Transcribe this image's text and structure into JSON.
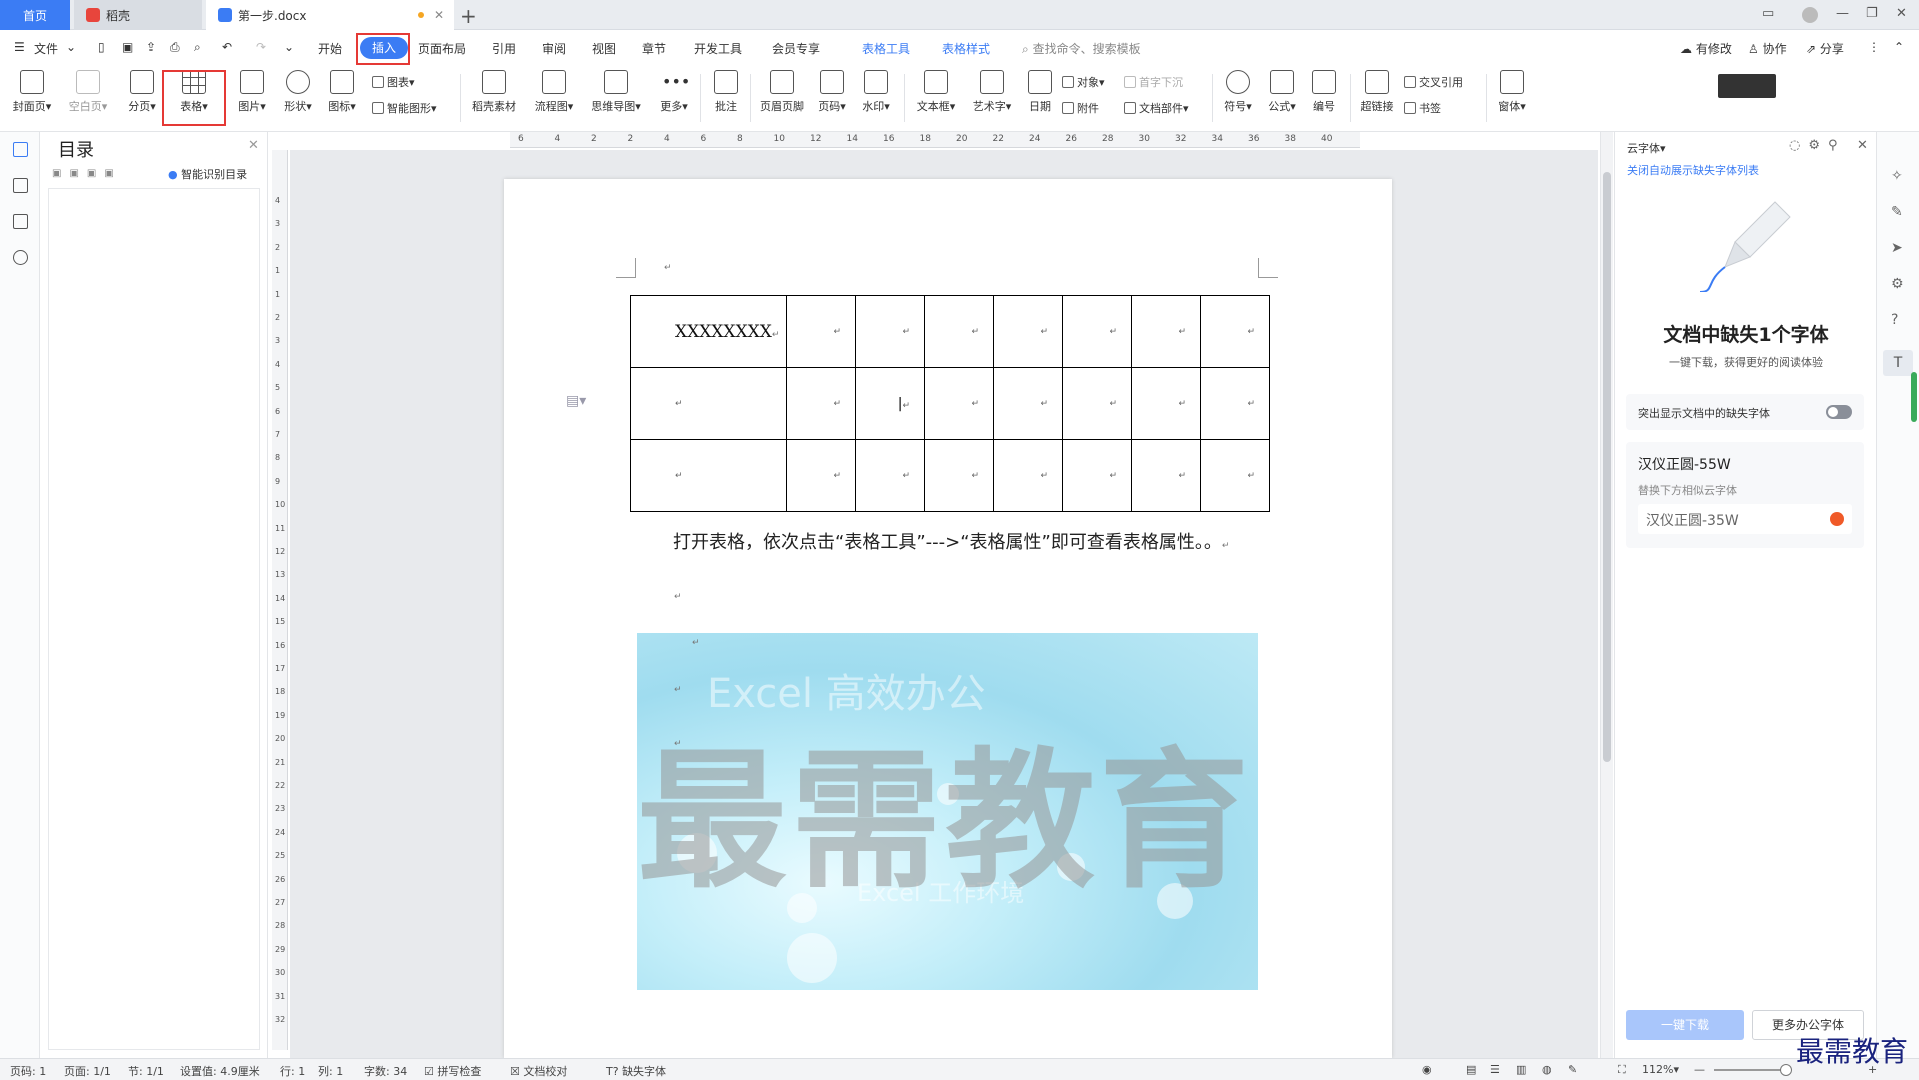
{
  "tabs": {
    "home": "首页",
    "daoke": "稻壳",
    "doc": "第一步.docx",
    "new_tab": "+"
  },
  "menu": {
    "file": "文件",
    "items": [
      "开始",
      "插入",
      "页面布局",
      "引用",
      "审阅",
      "视图",
      "章节",
      "开发工具",
      "会员专享"
    ],
    "context_tools": [
      "表格工具",
      "表格样式"
    ],
    "search_placeholder": "查找命令、搜索模板",
    "right": [
      "有修改",
      "协作",
      "分享"
    ]
  },
  "ribbon": {
    "large": [
      "封面页",
      "空白页",
      "分页",
      "表格",
      "图片",
      "形状",
      "图标",
      "稻壳素材",
      "流程图",
      "思维导图",
      "更多",
      "批注",
      "页眉页脚",
      "页码",
      "水印",
      "文本框",
      "艺术字",
      "日期",
      "符号",
      "公式",
      "编号",
      "超链接",
      "窗体"
    ],
    "small": {
      "chart": "图表",
      "smart_shape": "智能图形",
      "object": "对象",
      "drop_cap": "首字下沉",
      "attachment": "附件",
      "doc_parts": "文档部件",
      "cross_ref": "交叉引用",
      "bookmark": "书签"
    }
  },
  "toc": {
    "title": "目录",
    "smart_toc": "智能识别目录"
  },
  "document": {
    "cell_text": "XXXXXXXX",
    "paragraph": "打开表格，依次点击“表格工具”--->“表格属性”即可查看表格属性。。",
    "rows": 3,
    "cols": 8,
    "watermark": "最需教育",
    "image_text_top": "Excel 高效办公",
    "image_text_bottom": "Excel 工作环境"
  },
  "ruler": {
    "h_ticks": [
      "6",
      "4",
      "2",
      "2",
      "4",
      "6",
      "8",
      "10",
      "12",
      "14",
      "16",
      "18",
      "20",
      "22",
      "24",
      "26",
      "28",
      "30",
      "32",
      "34",
      "36",
      "38",
      "40"
    ],
    "v_ticks": [
      "4",
      "3",
      "2",
      "1",
      "1",
      "2",
      "3",
      "4",
      "5",
      "6",
      "7",
      "8",
      "9",
      "10",
      "11",
      "12",
      "13",
      "14",
      "15",
      "16",
      "17",
      "18",
      "19",
      "20",
      "21",
      "22",
      "23",
      "24",
      "25",
      "26",
      "27",
      "28",
      "29",
      "30",
      "31",
      "32"
    ]
  },
  "cloud_font": {
    "header": "云字体",
    "link": "关闭自动展示缺失字体列表",
    "title": "文档中缺失1个字体",
    "subtitle": "一键下载，获得更好的阅读体验",
    "toggle_label": "突出显示文档中的缺失字体",
    "missing_font": "汉仪正圆-55W",
    "replace_label": "替换下方相似云字体",
    "replacement": "汉仪正圆-35W",
    "download_btn": "一键下载",
    "more_btn": "更多办公字体"
  },
  "status": {
    "page_num": "页码: 1",
    "pages": "页面: 1/1",
    "section": "节: 1/1",
    "setting": "设置值: 4.9厘米",
    "line": "行: 1",
    "col": "列: 1",
    "words": "字数: 34",
    "spell": "拼写检查",
    "proof": "文档校对",
    "missing_font": "缺失字体",
    "zoom": "112%"
  },
  "brand": "最需教育",
  "colors": {
    "accent": "#3b7cf4",
    "highlight": "#e53935"
  }
}
